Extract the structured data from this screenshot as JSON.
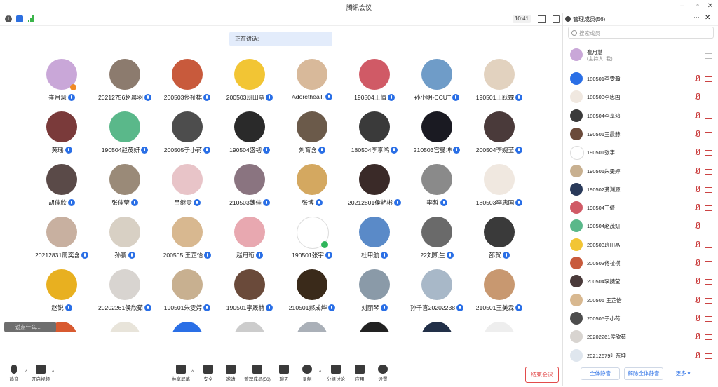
{
  "window": {
    "title": "腾讯会议",
    "clock": "10:41"
  },
  "speaking": "正在讲话:",
  "participants_grid": [
    {
      "name": "崔月慧",
      "color": "#c9a7d8"
    },
    {
      "name": "20212756赵晨羽",
      "color": "#8c7b6e"
    },
    {
      "name": "200503佟祉棋",
      "color": "#c85a3c"
    },
    {
      "name": "200503班田晶",
      "color": "#f2c534"
    },
    {
      "name": "Adoretheall.",
      "color": "#d8b99a"
    },
    {
      "name": "190504王倩",
      "color": "#d05a66"
    },
    {
      "name": "孙小明-CCUT",
      "color": "#6f9cc8"
    },
    {
      "name": "190501王跃霖",
      "color": "#e2d2bf"
    },
    {
      "name": "黄瑶",
      "color": "#7a3a3a"
    },
    {
      "name": "190504赵茂妍",
      "color": "#5ab88a"
    },
    {
      "name": "200505于小荷",
      "color": "#4d4d4d"
    },
    {
      "name": "190504盛韧",
      "color": "#2a2a2a"
    },
    {
      "name": "刘育含",
      "color": "#6b5a4a"
    },
    {
      "name": "180504李享鸿",
      "color": "#3a3a3a"
    },
    {
      "name": "210503宫曼坤",
      "color": "#1a1a22"
    },
    {
      "name": "200504李婉莹",
      "color": "#4a3a3a"
    },
    {
      "name": "胡佳欣",
      "color": "#5a4a48"
    },
    {
      "name": "张佳莹",
      "color": "#9a8a78"
    },
    {
      "name": "吕继雯",
      "color": "#e8c4c8"
    },
    {
      "name": "210503魏佳",
      "color": "#8a7480"
    },
    {
      "name": "张博",
      "color": "#d4a860"
    },
    {
      "name": "20212801侯艳彬",
      "color": "#3a2a28"
    },
    {
      "name": "李哲",
      "color": "#8a8a8a"
    },
    {
      "name": "180503李忠国",
      "color": "#f0e8e0"
    },
    {
      "name": "20212831周奕含",
      "color": "#c8b0a0"
    },
    {
      "name": "孙鹏",
      "color": "#d8d0c4"
    },
    {
      "name": "200505 王芷怡",
      "color": "#d8b890"
    },
    {
      "name": "赵丹珩",
      "color": "#e8a8b0"
    },
    {
      "name": "190501张宇",
      "color": "#ffffff"
    },
    {
      "name": "杜甲航",
      "color": "#5a8ac8"
    },
    {
      "name": "22刘凯生",
      "color": "#6a6a6a"
    },
    {
      "name": "邵贺",
      "color": "#3a3a3a"
    },
    {
      "name": "赵锐",
      "color": "#e8b020"
    },
    {
      "name": "20202261侯欣茹",
      "color": "#d8d4d0"
    },
    {
      "name": "190501朱雯婷",
      "color": "#c8b090"
    },
    {
      "name": "190501李晟赫",
      "color": "#6a4a3a"
    },
    {
      "name": "210501郝成烨",
      "color": "#3a2a1a"
    },
    {
      "name": "刘丽琴",
      "color": "#8a9aa8"
    },
    {
      "name": "孙千喜20202238",
      "color": "#a8b8c8"
    },
    {
      "name": "210501王美霖",
      "color": "#c89870"
    }
  ],
  "partial_row_colors": [
    "#d85a30",
    "#e8e4da",
    "#2a6fe6",
    "#cccccc",
    "#aab0b8",
    "#222222",
    "#223048",
    "#eeeeee"
  ],
  "chat_placeholder": "说点什么...",
  "toolbar": {
    "mute": "静音",
    "video": "开启视频",
    "share": "共享屏幕",
    "security": "安全",
    "invite": "邀请",
    "members": "管理成员(56)",
    "chat": "聊天",
    "record": "录制",
    "breakout": "分组讨论",
    "apps": "应用",
    "settings": "设置",
    "end": "结束会议"
  },
  "panel": {
    "title": "管理成员(56)",
    "search_placeholder": "搜索成员",
    "host_name": "崔月慧",
    "host_sub": "(主持人, 我)",
    "members": [
      {
        "name": "180501李雯瀚",
        "color": "#2a6fe6"
      },
      {
        "name": "180503李忠国",
        "color": "#f0e8e0"
      },
      {
        "name": "180504李享鸿",
        "color": "#3a3a3a"
      },
      {
        "name": "190501王晨赫",
        "color": "#6a4a3a"
      },
      {
        "name": "190501张宇",
        "color": "#ffffff"
      },
      {
        "name": "190501朱雯婷",
        "color": "#c8b090"
      },
      {
        "name": "190502龚渊源",
        "color": "#2a3a5a"
      },
      {
        "name": "190504王倩",
        "color": "#d05a66"
      },
      {
        "name": "190504赵茂妍",
        "color": "#5ab88a"
      },
      {
        "name": "200503班田晶",
        "color": "#f2c534"
      },
      {
        "name": "200503佟祉棋",
        "color": "#c85a3c"
      },
      {
        "name": "200504李婉莹",
        "color": "#4a3a3a"
      },
      {
        "name": "200505 王芷怡",
        "color": "#d8b890"
      },
      {
        "name": "200505于小荷",
        "color": "#4d4d4d"
      },
      {
        "name": "20202261侯欣茹",
        "color": "#d8d4d0"
      },
      {
        "name": "20212679叶东坤",
        "color": "#dfe6ee"
      }
    ],
    "mute_all": "全体静音",
    "unmute_all": "解除全体静音",
    "more": "更多"
  }
}
